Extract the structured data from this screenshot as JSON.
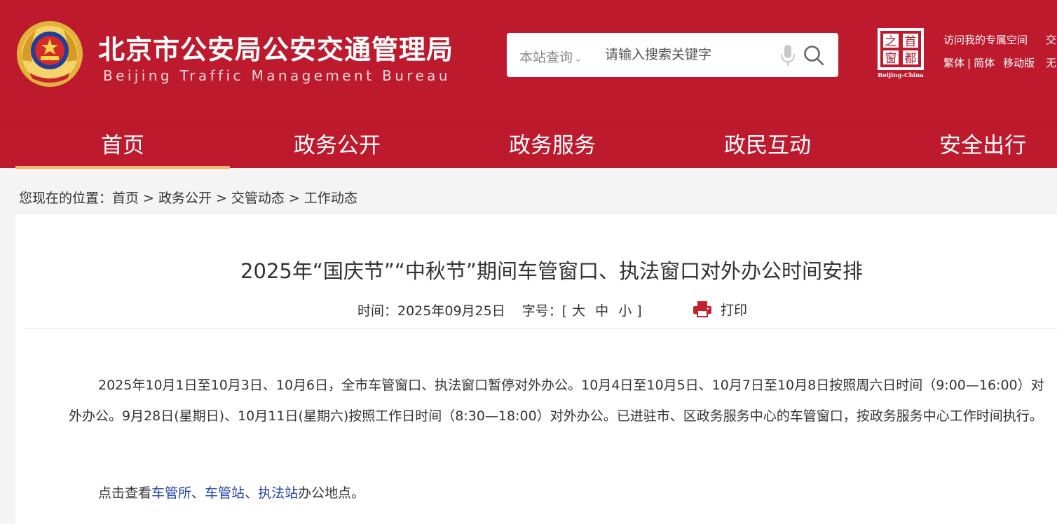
{
  "header": {
    "title_cn": "北京市公安局公安交通管理局",
    "title_en": "Beijing Traffic Management Bureau",
    "search": {
      "scope": "本站查询",
      "placeholder": "请输入搜索关键字"
    },
    "logo_text": [
      "首",
      "都",
      "之",
      "窗"
    ],
    "logo_caption": "Beijing-China",
    "links": {
      "my_space": "访问我的专属空间",
      "overflow_1": "交",
      "traditional": "繁体",
      "divider": "|",
      "simplified": "简体",
      "mobile": "移动版",
      "overflow_2": "无"
    }
  },
  "nav": [
    {
      "label": "首页",
      "active": true
    },
    {
      "label": "政务公开",
      "active": false
    },
    {
      "label": "政务服务",
      "active": false
    },
    {
      "label": "政民互动",
      "active": false
    },
    {
      "label": "安全出行",
      "active": false
    }
  ],
  "breadcrumb": {
    "prefix": "您现在的位置：",
    "items": [
      "首页",
      "政务公开",
      "交管动态",
      "工作动态"
    ],
    "separator": ">"
  },
  "article": {
    "title": "2025年“国庆节”“中秋节”期间车管窗口、执法窗口对外办公时间安排",
    "time_label": "时间：2025年09月25日",
    "font_label": "字号：",
    "bracket_open": "[",
    "font_sizes": [
      "大",
      "中",
      "小"
    ],
    "bracket_close": "]",
    "print_label": "打印",
    "paragraph1": "2025年10月1日至10月3日、10月6日，全市车管窗口、执法窗口暂停对外办公。10月4日至10月5日、10月7日至10月8日按照周六日时间（9:00—16:00）对外办公。9月28日(星期日)、10月11日(星期六)按照工作日时间（8:30—18:00）对外办公。已进驻市、区政务服务中心的车管窗口，按政务服务中心工作时间执行。",
    "paragraph2": {
      "prefix": "点击查看",
      "link1": "车管所",
      "sep1": "、",
      "link2": "车管站",
      "sep2": "、",
      "link3": "执法站",
      "suffix": "办公地点。"
    }
  },
  "colors": {
    "brand_red": "#bd1a2d",
    "nav_active_underline": "#f2b56b",
    "link_blue": "#1d3ea8",
    "print_icon": "#c8202f"
  },
  "icons": [
    "police-emblem-icon",
    "chevron-down-icon",
    "microphone-icon",
    "search-icon",
    "capital-window-logo",
    "printer-icon"
  ]
}
